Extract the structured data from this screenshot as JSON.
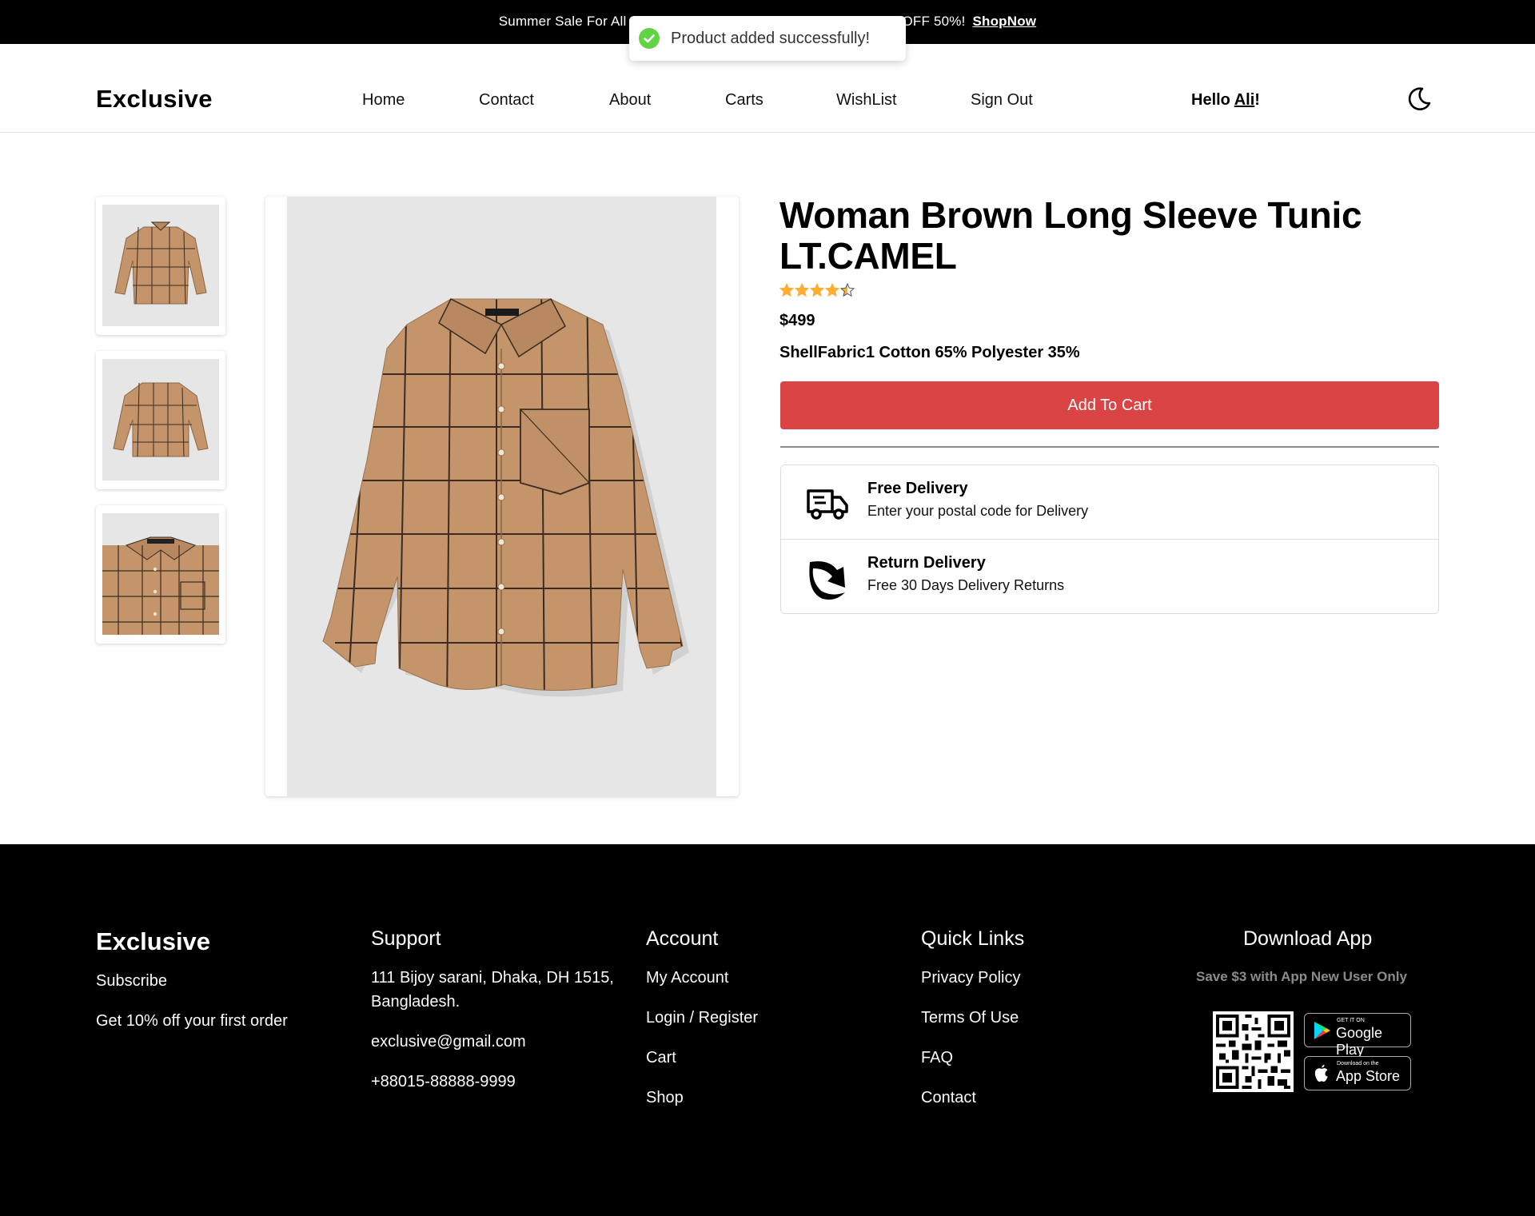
{
  "banner": {
    "text_start": "Summer Sale For All",
    "text_end": "OFF 50%!",
    "link": "ShopNow"
  },
  "toast": {
    "message": "Product added successfully!",
    "icon": "check-circle-icon",
    "color": "#61d345"
  },
  "header": {
    "logo": "Exclusive",
    "nav": [
      "Home",
      "Contact",
      "About",
      "Carts",
      "WishList",
      "Sign Out"
    ],
    "greeting_prefix": "Hello ",
    "greeting_user": "Ali",
    "greeting_suffix": "!",
    "theme_icon": "moon-icon"
  },
  "product": {
    "title": "Woman Brown Long Sleeve Tunic LT.CAMEL",
    "rating": 4.5,
    "rating_max": 5,
    "price": "$499",
    "material": "ShellFabric1 Cotton 65% Polyester 35%",
    "add_to_cart": "Add To Cart",
    "accent_color": "#db4444",
    "star_color": "#ffad33",
    "thumbnails": [
      "shirt-front",
      "shirt-back",
      "shirt-detail"
    ]
  },
  "delivery": {
    "free": {
      "title": "Free Delivery",
      "subtitle": "Enter your postal code for Delivery",
      "icon": "delivery-truck-icon"
    },
    "returns": {
      "title": "Return Delivery",
      "subtitle": "Free 30 Days Delivery Returns",
      "icon": "return-arrow-icon"
    }
  },
  "footer": {
    "logo": "Exclusive",
    "subscribe": "Subscribe",
    "offer": "Get 10% off your first order",
    "support": {
      "heading": "Support",
      "address_line1": "111 Bijoy sarani, Dhaka, DH 1515,",
      "address_line2": "Bangladesh.",
      "email": "exclusive@gmail.com",
      "phone": "+88015-88888-9999"
    },
    "account": {
      "heading": "Account",
      "items": [
        "My Account",
        "Login / Register",
        "Cart",
        "Shop"
      ]
    },
    "quick_links": {
      "heading": "Quick Links",
      "items": [
        "Privacy Policy",
        "Terms Of Use",
        "FAQ",
        "Contact"
      ]
    },
    "download": {
      "heading": "Download App",
      "note": "Save $3 with App New User Only",
      "google_small": "GET IT ON",
      "google_big": "Google Play",
      "apple_small": "Download on the",
      "apple_big": "App Store"
    }
  }
}
